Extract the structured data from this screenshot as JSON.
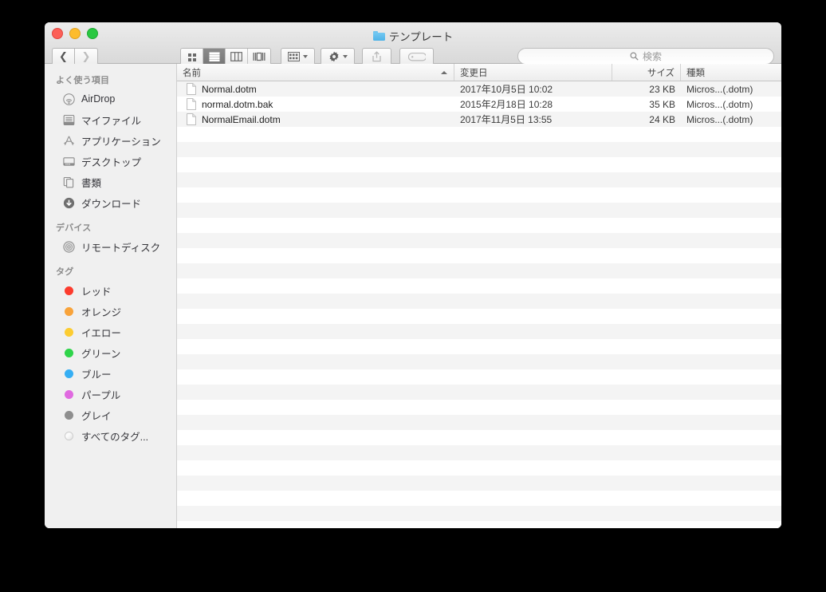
{
  "window": {
    "title": "テンプレート",
    "title_icon": "folder-icon",
    "traffic_lights": [
      {
        "name": "close",
        "color": "#fc5f57"
      },
      {
        "name": "minimize",
        "color": "#fdbc2d"
      },
      {
        "name": "maximize",
        "color": "#29c841"
      }
    ]
  },
  "toolbar": {
    "back_icon": "chevron-left-icon",
    "forward_icon": "chevron-right-icon",
    "view_modes": [
      {
        "name": "icon-view",
        "icon": "grid-icon",
        "active": false
      },
      {
        "name": "list-view",
        "icon": "list-icon",
        "active": true
      },
      {
        "name": "column-view",
        "icon": "columns-icon",
        "active": false
      },
      {
        "name": "coverflow-view",
        "icon": "coverflow-icon",
        "active": false
      }
    ],
    "arrange": {
      "name": "arrange-button",
      "icon": "grouping-icon"
    },
    "action": {
      "name": "action-button",
      "icon": "gear-icon"
    },
    "share": {
      "name": "share-button",
      "icon": "share-icon",
      "disabled": true
    },
    "tags": {
      "name": "tags-button",
      "icon": "tag-icon",
      "disabled": true
    }
  },
  "search": {
    "placeholder": "検索",
    "icon": "search-icon"
  },
  "sidebar": {
    "sections": [
      {
        "header": "よく使う項目",
        "items": [
          {
            "label": "AirDrop",
            "icon": "airdrop-icon"
          },
          {
            "label": "マイファイル",
            "icon": "myfiles-icon"
          },
          {
            "label": "アプリケーション",
            "icon": "applications-icon"
          },
          {
            "label": "デスクトップ",
            "icon": "desktop-icon"
          },
          {
            "label": "書類",
            "icon": "documents-icon"
          },
          {
            "label": "ダウンロード",
            "icon": "downloads-icon"
          }
        ]
      },
      {
        "header": "デバイス",
        "items": [
          {
            "label": "リモートディスク",
            "icon": "remote-disc-icon"
          }
        ]
      },
      {
        "header": "タグ",
        "items": [
          {
            "label": "レッド",
            "icon": "tag-dot",
            "color": "#fc3b2d"
          },
          {
            "label": "オレンジ",
            "icon": "tag-dot",
            "color": "#f8a33a"
          },
          {
            "label": "イエロー",
            "icon": "tag-dot",
            "color": "#fccc31"
          },
          {
            "label": "グリーン",
            "icon": "tag-dot",
            "color": "#2fd44a"
          },
          {
            "label": "ブルー",
            "icon": "tag-dot",
            "color": "#35aef3"
          },
          {
            "label": "パープル",
            "icon": "tag-dot",
            "color": "#e06ae0"
          },
          {
            "label": "グレイ",
            "icon": "tag-dot",
            "color": "#8e8e8e"
          },
          {
            "label": "すべてのタグ...",
            "icon": "tag-dot-hollow",
            "color": ""
          }
        ]
      }
    ]
  },
  "filelist": {
    "columns": [
      {
        "key": "name",
        "label": "名前",
        "sorted": "asc"
      },
      {
        "key": "date",
        "label": "変更日",
        "sorted": ""
      },
      {
        "key": "size",
        "label": "サイズ",
        "sorted": ""
      },
      {
        "key": "kind",
        "label": "種類",
        "sorted": ""
      }
    ],
    "rows": [
      {
        "name": "Normal.dotm",
        "date": "2017年10月5日 10:02",
        "size": "23 KB",
        "kind": "Micros...(.dotm)",
        "icon": "document-icon"
      },
      {
        "name": "normal.dotm.bak",
        "date": "2015年2月18日 10:28",
        "size": "35 KB",
        "kind": "Micros...(.dotm)",
        "icon": "document-icon"
      },
      {
        "name": "NormalEmail.dotm",
        "date": "2017年11月5日 13:55",
        "size": "24 KB",
        "kind": "Micros...(.dotm)",
        "icon": "document-icon"
      }
    ],
    "empty_row_count": 27
  }
}
